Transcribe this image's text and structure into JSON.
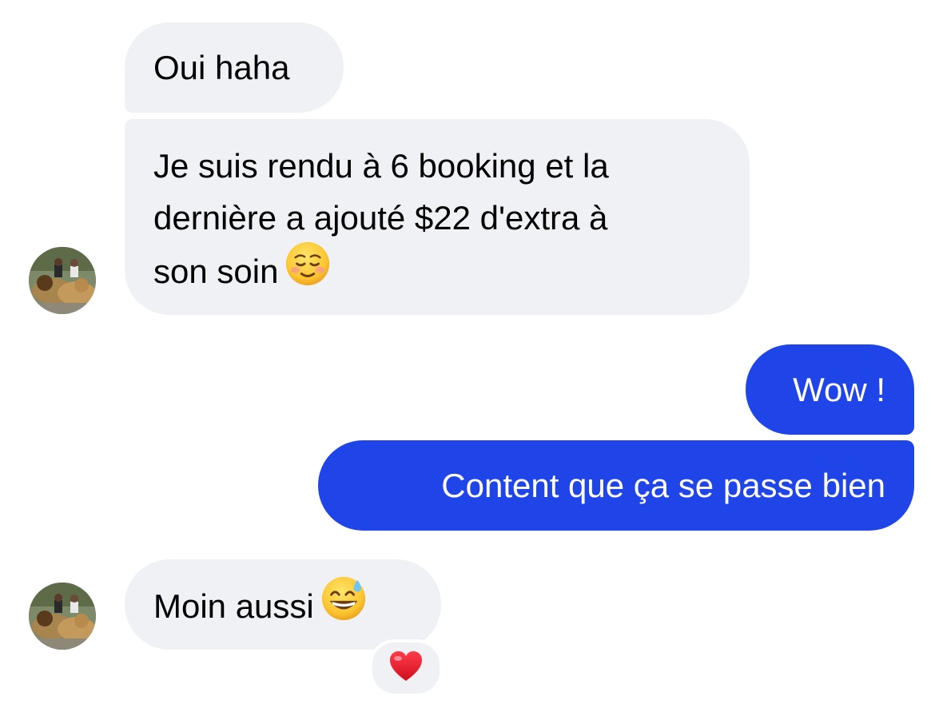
{
  "messages": [
    {
      "direction": "incoming",
      "text": "Oui haha"
    },
    {
      "direction": "incoming",
      "lines": [
        "Je suis rendu à 6 booking et la",
        "dernière a ajouté $22 d'extra à",
        "son soin"
      ],
      "emoji": "smiling-face-icon"
    },
    {
      "direction": "outgoing",
      "text": "Wow !"
    },
    {
      "direction": "outgoing",
      "text": "Content que ça se passe bien"
    },
    {
      "direction": "incoming",
      "text": "Moin aussi",
      "emoji": "grinning-sweat-icon",
      "reaction": "heart-icon"
    }
  ],
  "colors": {
    "incoming_bubble": "#f0f1f5",
    "outgoing_bubble": "#1f45e8",
    "outgoing_text": "#ffffff",
    "incoming_text": "#000000"
  }
}
